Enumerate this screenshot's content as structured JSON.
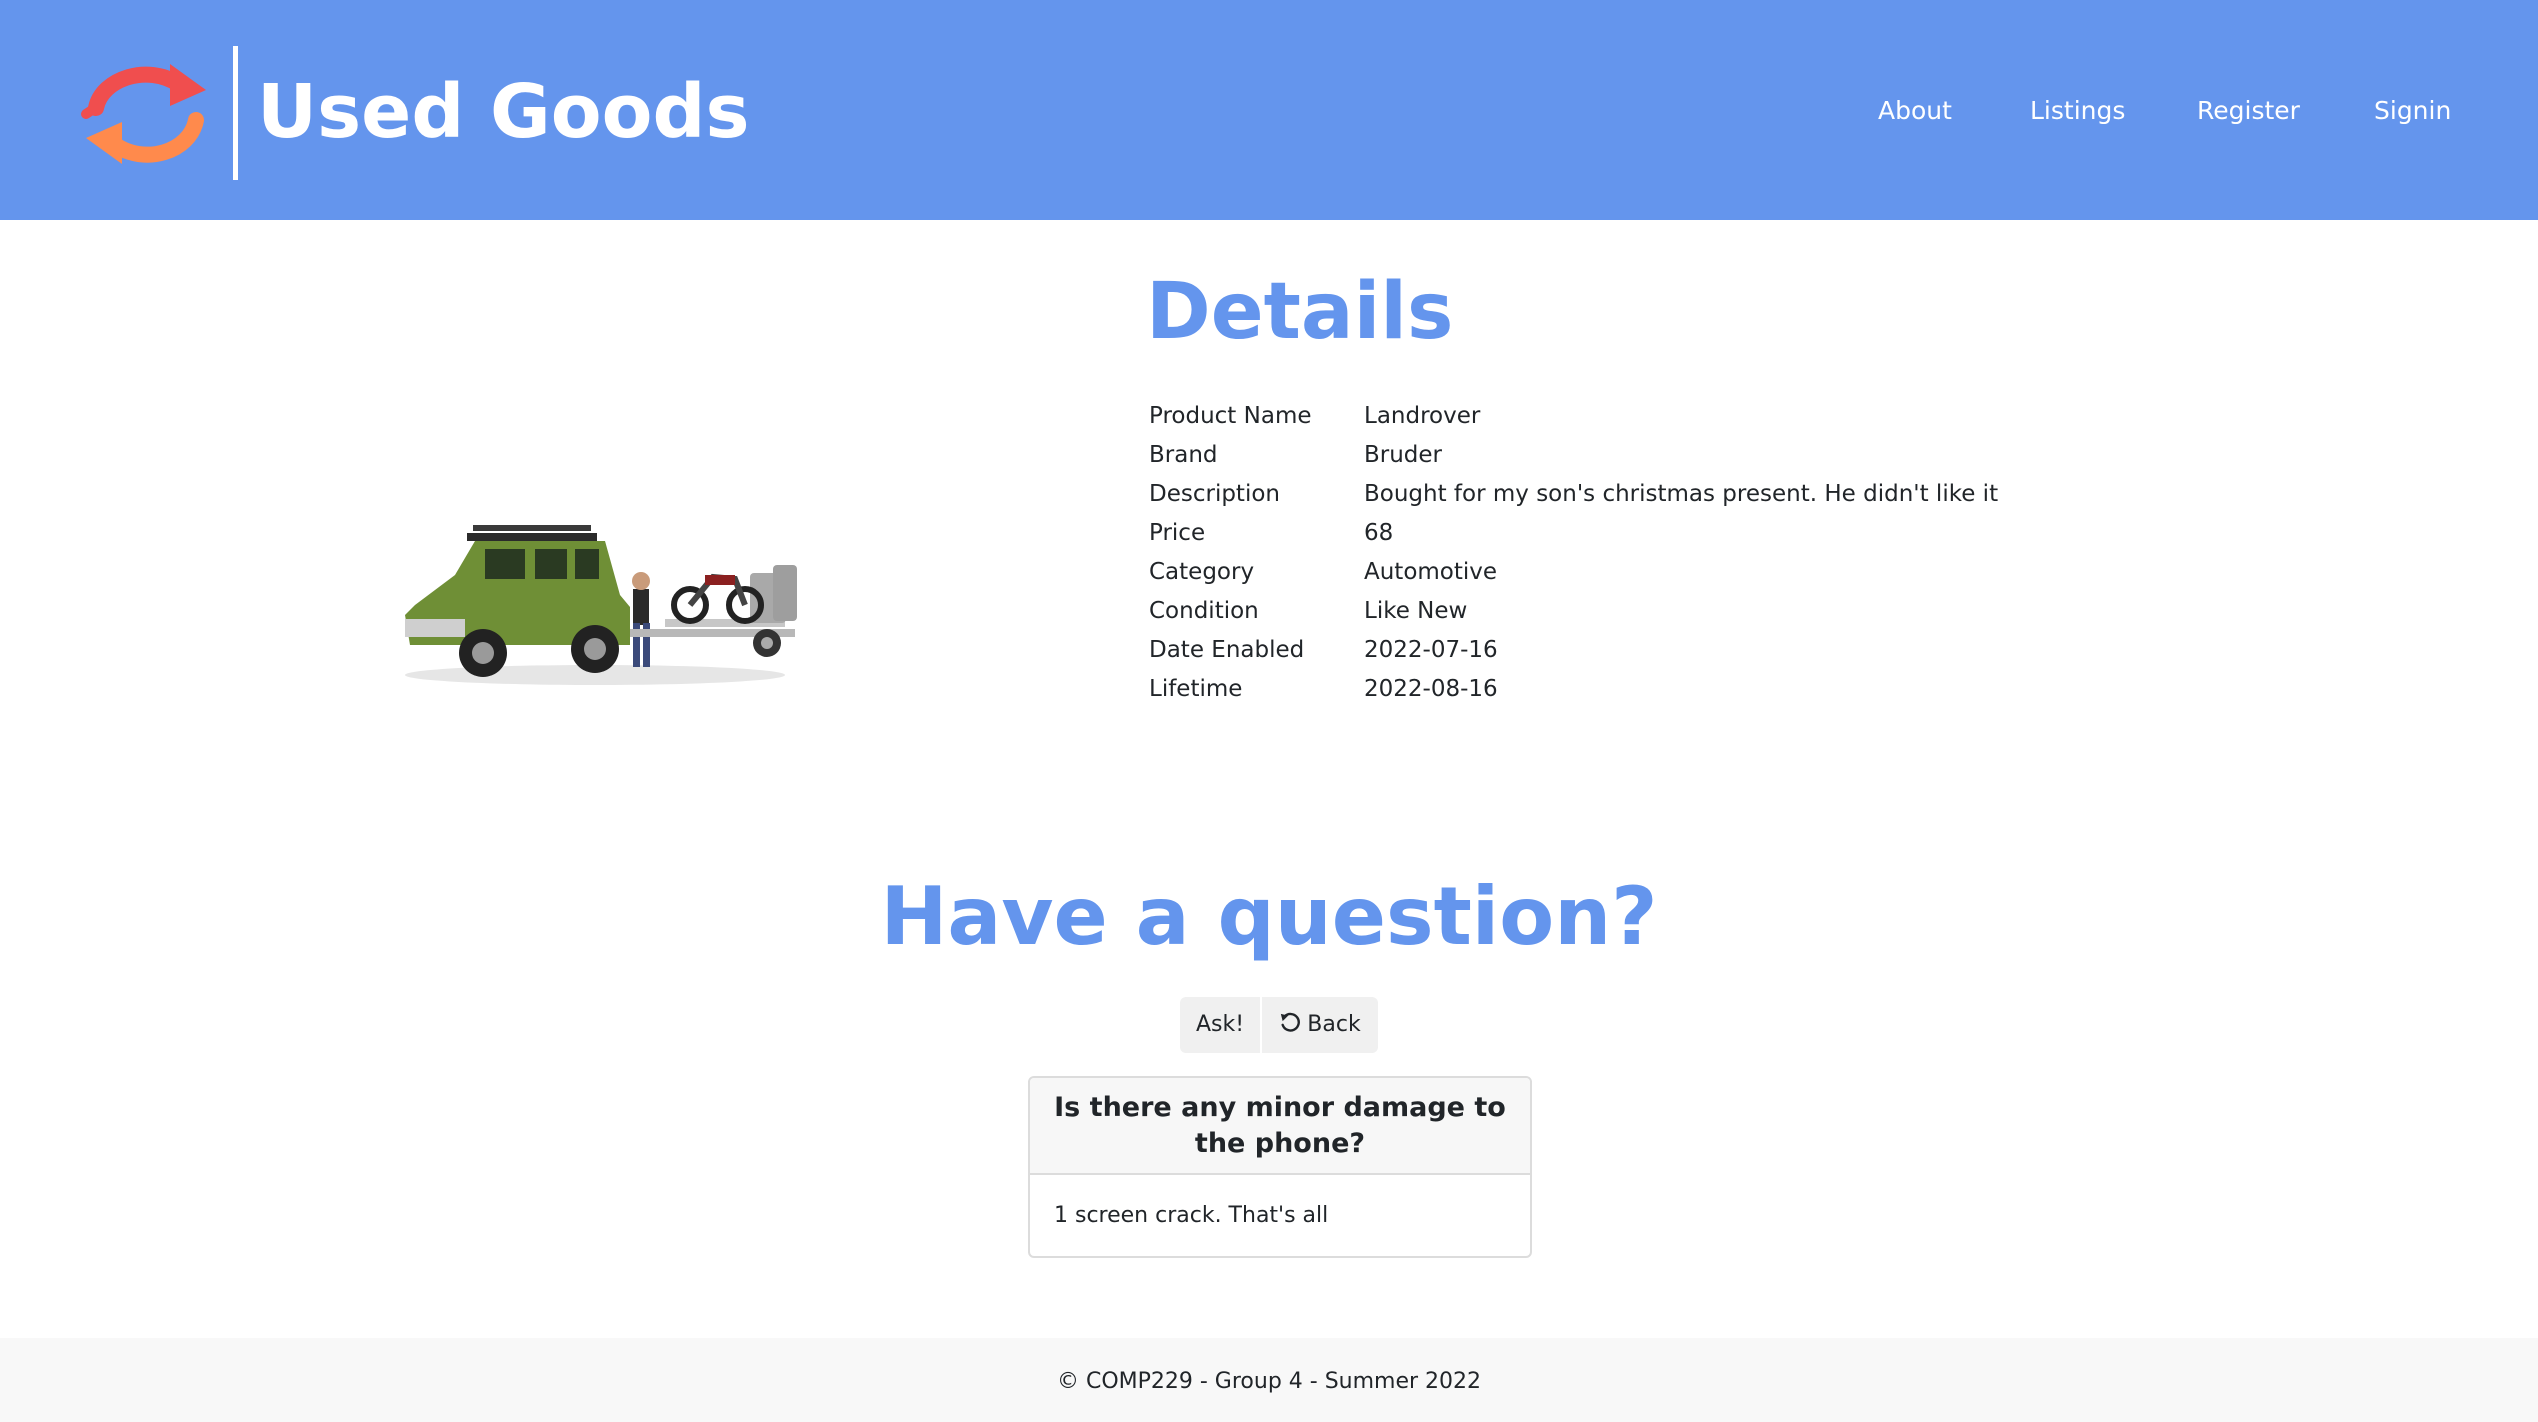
{
  "header": {
    "brand_name": "Used Goods",
    "nav": {
      "about": "About",
      "listings": "Listings",
      "register": "Register",
      "signin": "Signin"
    }
  },
  "details": {
    "title": "Details",
    "rows": [
      {
        "label": "Product Name",
        "value": "Landrover"
      },
      {
        "label": "Brand",
        "value": "Bruder"
      },
      {
        "label": "Description",
        "value": "Bought for my son's christmas present. He didn't like it"
      },
      {
        "label": "Price",
        "value": "68"
      },
      {
        "label": "Category",
        "value": "Automotive"
      },
      {
        "label": "Condition",
        "value": "Like New"
      },
      {
        "label": "Date Enabled",
        "value": "2022-07-16"
      },
      {
        "label": "Lifetime",
        "value": "2022-08-16"
      }
    ]
  },
  "questions": {
    "title": "Have a question?",
    "ask_label": "Ask!",
    "back_label": "Back",
    "items": [
      {
        "question": "Is there any minor damage to the phone?",
        "answer": "1 screen crack. That's all"
      }
    ]
  },
  "footer": {
    "text": "© COMP229 - Group 4 - Summer 2022"
  },
  "colors": {
    "brand": "#6495ED",
    "logo_red": "#F04E4E",
    "logo_orange": "#FF8A4C",
    "button_bg": "#f0f0f0",
    "footer_bg": "#f8f8f8"
  },
  "icons": {
    "logo": "recycle-arrows-icon",
    "back": "undo-arrow-icon"
  }
}
